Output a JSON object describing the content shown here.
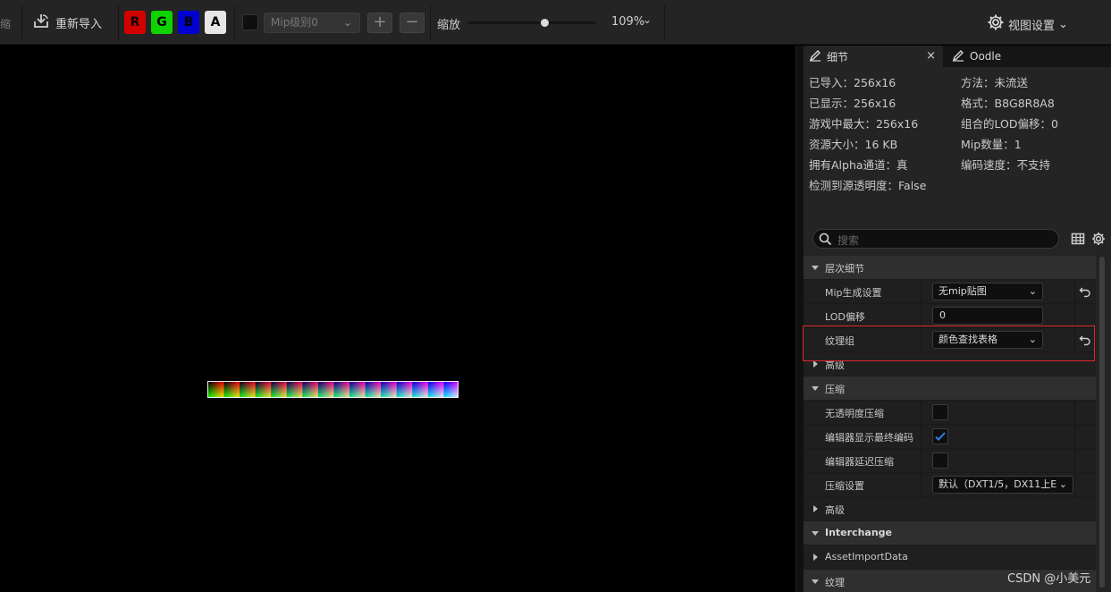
{
  "toolbar": {
    "cut_label": "缩",
    "reimport_label": "重新导入",
    "channels": [
      "R",
      "G",
      "B",
      "A"
    ],
    "mip_level_label": "Mip级别0",
    "plus_label": "+",
    "minus_label": "−",
    "zoom_label": "缩放",
    "zoom_value": "109%",
    "zoom_fraction": 0.6,
    "view_settings_label": "视图设置"
  },
  "tabs": [
    {
      "label": "细节",
      "active": true
    },
    {
      "label": "Oodle",
      "active": false
    }
  ],
  "info": {
    "left": [
      "已导入：256x16",
      "已显示：256x16",
      "游戏中最大：256x16",
      "资源大小：16 KB",
      "拥有Alpha通道：真",
      "检测到源透明度：False"
    ],
    "right": [
      "方法：未流送",
      "格式：B8G8R8A8",
      "组合的LOD偏移：0",
      "Mip数量：1",
      "编码速度：不支持"
    ]
  },
  "search": {
    "placeholder": "搜索"
  },
  "details": {
    "cat_lod": "层次细节",
    "mip_gen_label": "Mip生成设置",
    "mip_gen_value": "无mip贴图",
    "lod_bias_label": "LOD偏移",
    "lod_bias_value": "0",
    "texture_group_label": "纹理组",
    "texture_group_value": "颜色查找表格",
    "advanced_1": "高级",
    "cat_compression": "压缩",
    "no_alpha_label": "无透明度压缩",
    "no_alpha_checked": false,
    "editor_final_label": "编辑器显示最终编码",
    "editor_final_checked": true,
    "editor_defer_label": "编辑器延迟压缩",
    "editor_defer_checked": false,
    "compression_settings_label": "压缩设置",
    "compression_settings_value": "默认（DXT1/5，DX11上E",
    "advanced_2": "高级",
    "cat_interchange": "Interchange",
    "asset_import_data": "AssetImportData",
    "cat_texture": "纹理"
  },
  "colors": {
    "highlight": "#e0262e",
    "checkbox_check": "#2f7fe0",
    "channel_r": "#d30000",
    "channel_g": "#0ed300",
    "channel_b": "#0000d3",
    "channel_a": "#e6e6e6"
  },
  "watermark": "CSDN @小美元"
}
